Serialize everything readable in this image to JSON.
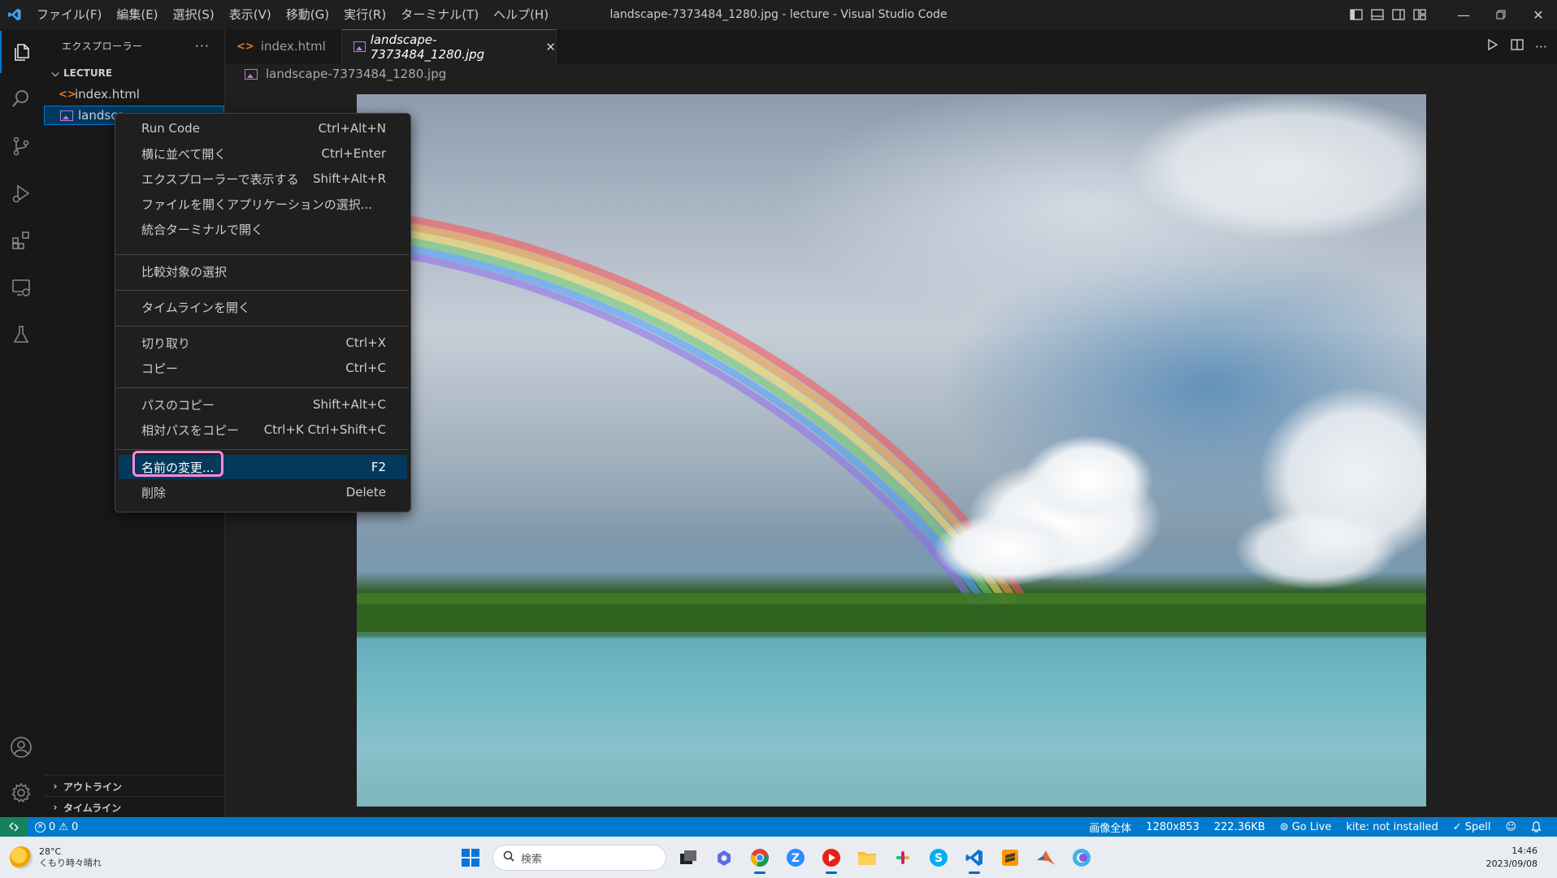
{
  "titlebar": {
    "menus": [
      "ファイル(F)",
      "編集(E)",
      "選択(S)",
      "表示(V)",
      "移動(G)",
      "実行(R)",
      "ターミナル(T)",
      "ヘルプ(H)"
    ],
    "window_title": "landscape-7373484_1280.jpg - lecture - Visual Studio Code"
  },
  "sidebar": {
    "title": "エクスプローラー",
    "more": "···",
    "folder": "LECTURE",
    "files": [
      {
        "name": "index.html",
        "icon": "html-file-icon"
      },
      {
        "name": "landscape-7373484_1280.jpg",
        "visible_name": "landsca",
        "icon": "image-file-icon"
      }
    ],
    "outline": "アウトライン",
    "timeline": "タイムライン"
  },
  "tabs": [
    {
      "label": "index.html",
      "icon": "html-file-icon",
      "active": false
    },
    {
      "label": "landscape-7373484_1280.jpg",
      "icon": "image-file-icon",
      "active": true,
      "close": "✕"
    }
  ],
  "breadcrumb": "landscape-7373484_1280.jpg",
  "context_menu": {
    "items": [
      {
        "label": "Run Code",
        "key": "Ctrl+Alt+N"
      },
      {
        "label": "横に並べて開く",
        "key": "Ctrl+Enter"
      },
      {
        "label": "エクスプローラーで表示する",
        "key": "Shift+Alt+R"
      },
      {
        "label": "ファイルを開くアプリケーションの選択...",
        "key": ""
      },
      {
        "label": "統合ターミナルで開く",
        "key": ""
      },
      {
        "label": "比較対象の選択",
        "key": ""
      },
      {
        "label": "タイムラインを開く",
        "key": ""
      },
      {
        "label": "切り取り",
        "key": "Ctrl+X"
      },
      {
        "label": "コピー",
        "key": "Ctrl+C"
      },
      {
        "label": "パスのコピー",
        "key": "Shift+Alt+C"
      },
      {
        "label": "相対パスをコピー",
        "key": "Ctrl+K Ctrl+Shift+C"
      },
      {
        "label": "名前の変更...",
        "key": "F2"
      },
      {
        "label": "削除",
        "key": "Delete"
      }
    ],
    "highlighted_index": 11
  },
  "statusbar": {
    "errors": "0",
    "warnings": "0",
    "zoom": "画像全体",
    "dimensions": "1280x853",
    "size": "222.36KB",
    "go_live": "Go Live",
    "kite": "kite: not installed",
    "spell": "Spell"
  },
  "taskbar": {
    "temperature": "28°C",
    "weather": "くもり時々晴れ",
    "search_placeholder": "検索",
    "time": "14:46",
    "date": "2023/09/08"
  },
  "colors": {
    "accent": "#0078d4",
    "statusbar": "#007acc",
    "remote": "#16825d",
    "highlight_ring": "#ff8ad1",
    "selection": "#04395e"
  }
}
